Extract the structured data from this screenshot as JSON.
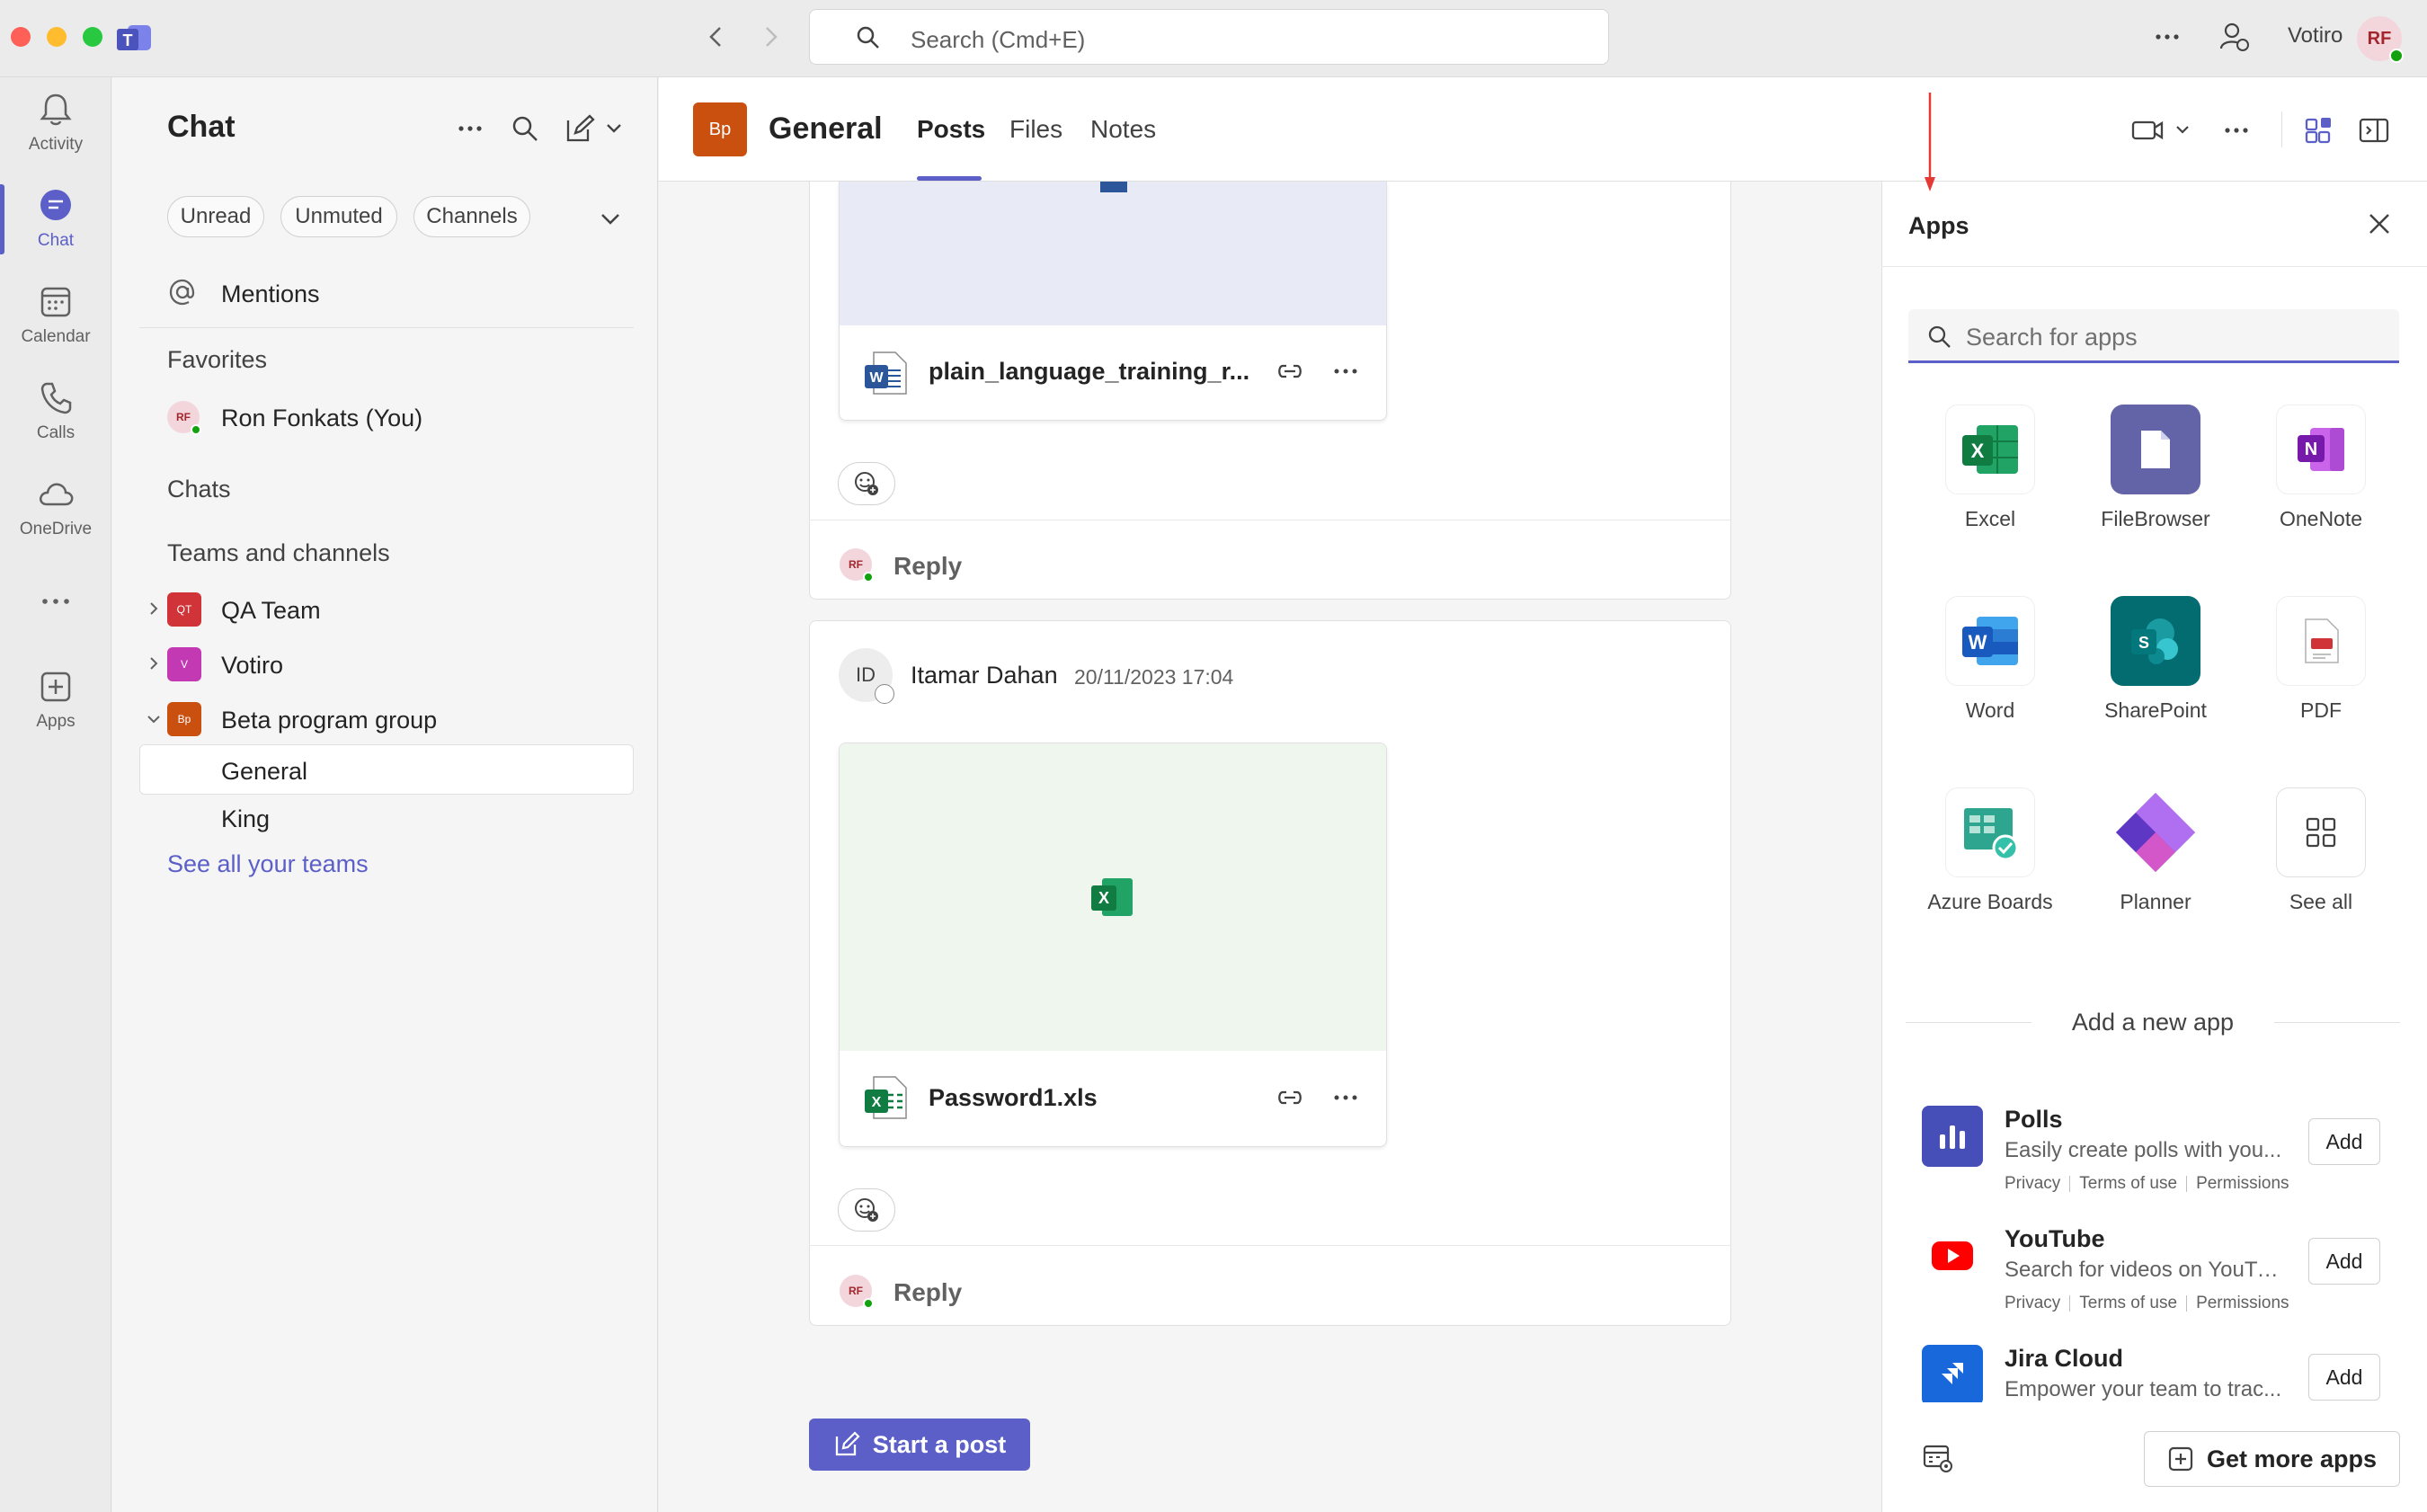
{
  "titlebar": {
    "search_placeholder": "Search (Cmd+E)",
    "org_name": "Votiro",
    "user_initials": "RF"
  },
  "rail": {
    "items": [
      {
        "label": "Activity",
        "icon": "bell-icon"
      },
      {
        "label": "Chat",
        "icon": "chat-icon",
        "active": true
      },
      {
        "label": "Calendar",
        "icon": "calendar-icon"
      },
      {
        "label": "Calls",
        "icon": "phone-icon"
      },
      {
        "label": "OneDrive",
        "icon": "cloud-icon"
      },
      {
        "label": "Apps",
        "icon": "add-app-icon"
      }
    ]
  },
  "chat_panel": {
    "title": "Chat",
    "filters": [
      "Unread",
      "Unmuted",
      "Channels"
    ],
    "mentions": "Mentions",
    "favorites_label": "Favorites",
    "favorite_user": "Ron Fonkats (You)",
    "favorite_user_initials": "RF",
    "chats_label": "Chats",
    "teams_label": "Teams and channels",
    "teams": [
      {
        "name": "QA Team",
        "badge": "QT",
        "color": "#d13438"
      },
      {
        "name": "Votiro",
        "badge": "V",
        "color": "#c239b3"
      },
      {
        "name": "Beta program group",
        "badge": "Bp",
        "color": "#ca5010"
      }
    ],
    "channels": [
      "General",
      "King"
    ],
    "see_all": "See all your teams"
  },
  "channel": {
    "badge": "Bp",
    "name": "General",
    "tabs": [
      "Posts",
      "Files",
      "Notes"
    ]
  },
  "posts": [
    {
      "file_name": "plain_language_training_r...",
      "reply_label": "Reply",
      "reply_initials": "RF"
    },
    {
      "author_initials": "ID",
      "author": "Itamar Dahan",
      "timestamp": "20/11/2023 17:04",
      "file_name": "Password1.xls",
      "reply_label": "Reply",
      "reply_initials": "RF"
    }
  ],
  "start_post": "Start a post",
  "apps_panel": {
    "title": "Apps",
    "search_placeholder": "Search for apps",
    "apps": [
      {
        "label": "Excel",
        "icon": "excel-icon"
      },
      {
        "label": "FileBrowser",
        "icon": "filebrowser-icon"
      },
      {
        "label": "OneNote",
        "icon": "onenote-icon"
      },
      {
        "label": "Word",
        "icon": "word-icon"
      },
      {
        "label": "SharePoint",
        "icon": "sharepoint-icon"
      },
      {
        "label": "PDF",
        "icon": "pdf-icon"
      },
      {
        "label": "Azure Boards",
        "icon": "azure-boards-icon"
      },
      {
        "label": "Planner",
        "icon": "planner-icon"
      },
      {
        "label": "See all",
        "icon": "grid-icon"
      }
    ],
    "add_new_title": "Add a new app",
    "store": [
      {
        "name": "Polls",
        "desc": "Easily create polls with you...",
        "links": [
          "Privacy",
          "Terms of use",
          "Permissions"
        ],
        "add": "Add"
      },
      {
        "name": "YouTube",
        "desc": "Search for videos on YouTu...",
        "links": [
          "Privacy",
          "Terms of use",
          "Permissions"
        ],
        "add": "Add"
      },
      {
        "name": "Jira Cloud",
        "desc": "Empower your team to trac...",
        "add": "Add"
      }
    ],
    "get_more": "Get more apps"
  }
}
